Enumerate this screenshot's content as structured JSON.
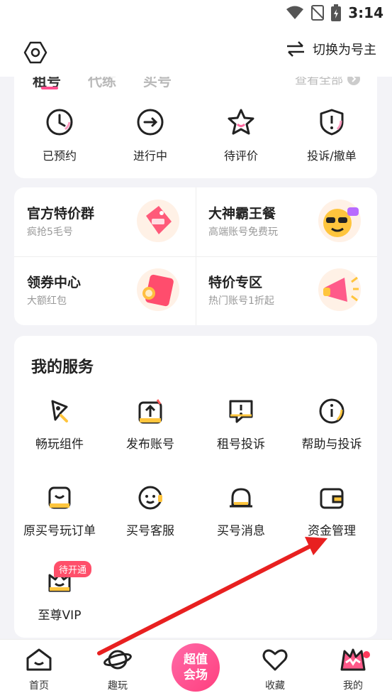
{
  "status_bar": {
    "time": "3:14"
  },
  "header": {
    "switch_label": "切换为号主"
  },
  "orders": {
    "tabs": [
      "租号",
      "代练",
      "买号"
    ],
    "view_all": "查看全部",
    "items": [
      "已预约",
      "进行中",
      "待评价",
      "投诉/撤单"
    ]
  },
  "promos": [
    {
      "title": "官方特价群",
      "subtitle": "疯抢5毛号"
    },
    {
      "title": "大神霸王餐",
      "subtitle": "高端账号免费玩"
    },
    {
      "title": "领券中心",
      "subtitle": "大额红包"
    },
    {
      "title": "特价专区",
      "subtitle": "热门账号1折起"
    }
  ],
  "services": {
    "title": "我的服务",
    "items": [
      "畅玩组件",
      "发布账号",
      "租号投诉",
      "帮助与投诉",
      "原买号玩订单",
      "买号客服",
      "买号消息",
      "资金管理",
      "至尊VIP"
    ],
    "vip_badge": "待开通"
  },
  "tabbar": {
    "items": [
      "首页",
      "趣玩",
      "收藏",
      "我的"
    ],
    "center_line1": "超值",
    "center_line2": "会场"
  },
  "colors": {
    "accent": "#ff4e8e",
    "arrow": "#e82020",
    "badge": "#ff4f6a"
  }
}
